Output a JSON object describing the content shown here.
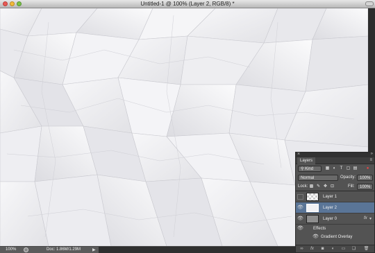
{
  "window": {
    "title": "Untitled-1 @ 100% (Layer 2, RGB/8) *"
  },
  "status": {
    "zoom": "100%",
    "doc": "Doc: 1.86M/1.29M"
  },
  "layers_panel": {
    "tab_label": "Layers",
    "filter": {
      "kind_label": "Kind"
    },
    "blend_mode": "Normal",
    "opacity_label": "Opacity:",
    "opacity_value": "100%",
    "lock_label": "Lock:",
    "fill_label": "Fill:",
    "fill_value": "100%",
    "layers": [
      {
        "name": "Layer 1",
        "selected": false,
        "visible": false
      },
      {
        "name": "Layer 2",
        "selected": true,
        "visible": true
      },
      {
        "name": "Layer 0",
        "selected": false,
        "visible": true,
        "fx": "fx"
      }
    ],
    "effects_label": "Effects",
    "effect_item": "Gradient Overlay"
  }
}
